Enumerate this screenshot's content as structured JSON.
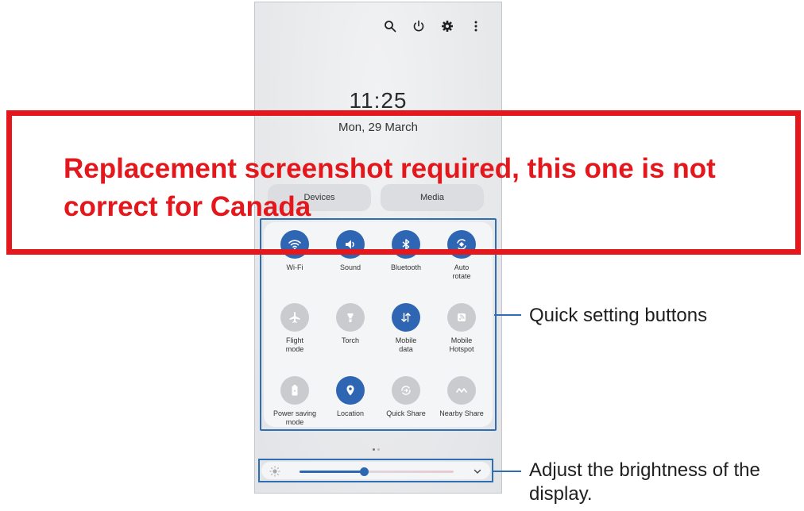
{
  "status": {
    "time": "11:25",
    "date": "Mon, 29 March"
  },
  "top_icons": [
    "search-icon",
    "power-icon",
    "gear-icon",
    "more-vert-icon"
  ],
  "panel_buttons": {
    "devices": "Devices",
    "media": "Media"
  },
  "quick_settings": {
    "tiles": [
      {
        "label": "Wi-Fi",
        "icon": "wifi-icon",
        "state": "on"
      },
      {
        "label": "Sound",
        "icon": "sound-icon",
        "state": "on"
      },
      {
        "label": "Bluetooth",
        "icon": "bluetooth-icon",
        "state": "on"
      },
      {
        "label": "Auto\nrotate",
        "icon": "auto-rotate-icon",
        "state": "on"
      },
      {
        "label": "Flight\nmode",
        "icon": "airplane-icon",
        "state": "off"
      },
      {
        "label": "Torch",
        "icon": "torch-icon",
        "state": "off"
      },
      {
        "label": "Mobile\ndata",
        "icon": "mobile-data-icon",
        "state": "on"
      },
      {
        "label": "Mobile\nHotspot",
        "icon": "hotspot-icon",
        "state": "off"
      },
      {
        "label": "Power saving\nmode",
        "icon": "battery-icon",
        "state": "off"
      },
      {
        "label": "Location",
        "icon": "location-icon",
        "state": "on"
      },
      {
        "label": "Quick Share",
        "icon": "quick-share-icon",
        "state": "off"
      },
      {
        "label": "Nearby Share",
        "icon": "nearby-share-icon",
        "state": "off"
      }
    ]
  },
  "brightness": {
    "level": 0.42,
    "icon": "brightness-icon"
  },
  "callouts": {
    "quick_settings": "Quick setting buttons",
    "brightness": "Adjust the brightness of the display."
  },
  "notice": {
    "text": "Replacement screenshot required, this one is not correct for Canada"
  },
  "colors": {
    "accent": "#2f66b3",
    "callout": "#2f6eb3",
    "notice": "#e3171c"
  }
}
